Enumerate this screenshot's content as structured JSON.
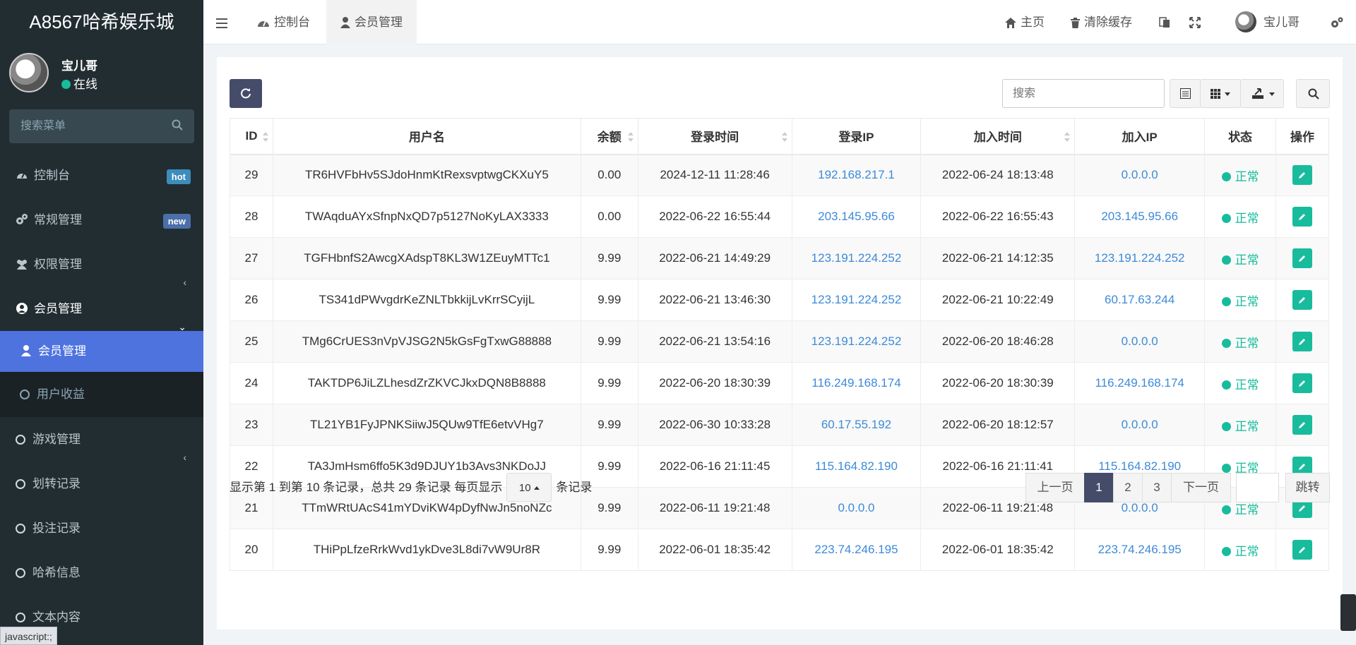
{
  "app": {
    "title": "A8567哈希娱乐城"
  },
  "user": {
    "name": "宝儿哥",
    "status": "在线"
  },
  "sidebar": {
    "search_placeholder": "搜索菜单",
    "items": [
      {
        "label": "控制台",
        "badge": "hot"
      },
      {
        "label": "常规管理",
        "badge": "new"
      },
      {
        "label": "权限管理"
      },
      {
        "label": "会员管理"
      },
      {
        "label": "会员管理"
      },
      {
        "label": "用户收益"
      },
      {
        "label": "游戏管理"
      },
      {
        "label": "划转记录"
      },
      {
        "label": "投注记录"
      },
      {
        "label": "哈希信息"
      },
      {
        "label": "文本内容"
      }
    ],
    "status_url": "javascript:;"
  },
  "topbar": {
    "tabs": [
      {
        "label": "控制台"
      },
      {
        "label": "会员管理"
      }
    ],
    "home": "主页",
    "clear_cache": "清除缓存",
    "user_name": "宝儿哥"
  },
  "toolbar": {
    "search_placeholder": "搜索"
  },
  "table": {
    "headers": [
      "ID",
      "用户名",
      "余额",
      "登录时间",
      "登录IP",
      "加入时间",
      "加入IP",
      "状态",
      "操作"
    ],
    "rows": [
      {
        "id": "29",
        "username": "TR6HVFbHv5SJdoHnmKtRexsvptwgCKXuY5",
        "balance": "0.00",
        "login_time": "2024-12-11 11:28:46",
        "login_ip": "192.168.217.1",
        "join_time": "2022-06-24 18:13:48",
        "join_ip": "0.0.0.0",
        "status": "正常"
      },
      {
        "id": "28",
        "username": "TWAqduAYxSfnpNxQD7p5127NoKyLAX3333",
        "balance": "0.00",
        "login_time": "2022-06-22 16:55:44",
        "login_ip": "203.145.95.66",
        "join_time": "2022-06-22 16:55:43",
        "join_ip": "203.145.95.66",
        "status": "正常"
      },
      {
        "id": "27",
        "username": "TGFHbnfS2AwcgXAdspT8KL3W1ZEuyMTTc1",
        "balance": "9.99",
        "login_time": "2022-06-21 14:49:29",
        "login_ip": "123.191.224.252",
        "join_time": "2022-06-21 14:12:35",
        "join_ip": "123.191.224.252",
        "status": "正常"
      },
      {
        "id": "26",
        "username": "TS341dPWvgdrKeZNLTbkkijLvKrrSCyijL",
        "balance": "9.99",
        "login_time": "2022-06-21 13:46:30",
        "login_ip": "123.191.224.252",
        "join_time": "2022-06-21 10:22:49",
        "join_ip": "60.17.63.244",
        "status": "正常"
      },
      {
        "id": "25",
        "username": "TMg6CrUES3nVpVJSG2N5kGsFgTxwG88888",
        "balance": "9.99",
        "login_time": "2022-06-21 13:54:16",
        "login_ip": "123.191.224.252",
        "join_time": "2022-06-20 18:46:28",
        "join_ip": "0.0.0.0",
        "status": "正常"
      },
      {
        "id": "24",
        "username": "TAKTDP6JiLZLhesdZrZKVCJkxDQN8B8888",
        "balance": "9.99",
        "login_time": "2022-06-20 18:30:39",
        "login_ip": "116.249.168.174",
        "join_time": "2022-06-20 18:30:39",
        "join_ip": "116.249.168.174",
        "status": "正常"
      },
      {
        "id": "23",
        "username": "TL21YB1FyJPNKSiiwJ5QUw9TfE6etvVHg7",
        "balance": "9.99",
        "login_time": "2022-06-30 10:33:28",
        "login_ip": "60.17.55.192",
        "join_time": "2022-06-20 18:12:57",
        "join_ip": "0.0.0.0",
        "status": "正常"
      },
      {
        "id": "22",
        "username": "TA3JmHsm6ffo5K3d9DJUY1b3Avs3NKDoJJ",
        "balance": "9.99",
        "login_time": "2022-06-16 21:11:45",
        "login_ip": "115.164.82.190",
        "join_time": "2022-06-16 21:11:41",
        "join_ip": "115.164.82.190",
        "status": "正常"
      },
      {
        "id": "21",
        "username": "TTmWRtUAcS41mYDviKW4pDyfNwJn5noNZc",
        "balance": "9.99",
        "login_time": "2022-06-11 19:21:48",
        "login_ip": "0.0.0.0",
        "join_time": "2022-06-11 19:21:48",
        "join_ip": "0.0.0.0",
        "status": "正常"
      },
      {
        "id": "20",
        "username": "THiPpLfzeRrkWvd1ykDve3L8di7vW9Ur8R",
        "balance": "9.99",
        "login_time": "2022-06-01 18:35:42",
        "login_ip": "223.74.246.195",
        "join_time": "2022-06-01 18:35:42",
        "join_ip": "223.74.246.195",
        "status": "正常"
      }
    ]
  },
  "pagination": {
    "info": "显示第 1 到第 10 条记录，总共 29 条记录 每页显示",
    "per_page": "10",
    "per_page_suffix": "条记录",
    "prev": "上一页",
    "pages": [
      "1",
      "2",
      "3"
    ],
    "next": "下一页",
    "jump": "跳转"
  },
  "colors": {
    "sidebar_bg": "#222d32",
    "accent": "#4e73df",
    "success": "#18bc9c",
    "link": "#3d8ad8",
    "primary_btn": "#444c6a"
  }
}
